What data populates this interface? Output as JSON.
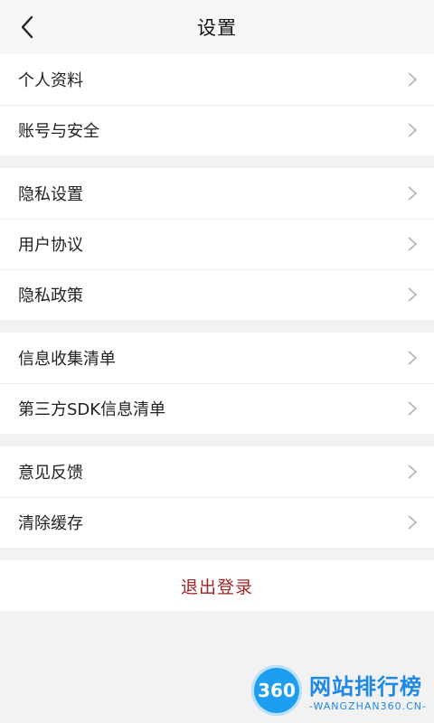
{
  "header": {
    "title": "设置",
    "back_icon": "chevron-left-icon"
  },
  "groups": [
    [
      {
        "label": "个人资料",
        "name": "personal-info"
      },
      {
        "label": "账号与安全",
        "name": "account-security"
      }
    ],
    [
      {
        "label": "隐私设置",
        "name": "privacy-settings"
      },
      {
        "label": "用户协议",
        "name": "user-agreement"
      },
      {
        "label": "隐私政策",
        "name": "privacy-policy"
      }
    ],
    [
      {
        "label": "信息收集清单",
        "name": "info-collection-list"
      },
      {
        "label": "第三方SDK信息清单",
        "name": "third-party-sdk-list"
      }
    ],
    [
      {
        "label": "意见反馈",
        "name": "feedback"
      },
      {
        "label": "清除缓存",
        "name": "clear-cache"
      }
    ]
  ],
  "logout": {
    "label": "退出登录"
  },
  "watermark": {
    "logo_text": "360",
    "title": "网站排行榜",
    "subtitle": "-WANGZHAN360.CN-"
  },
  "colors": {
    "logout": "#a42424",
    "background": "#f2f2f2",
    "accent_watermark": "#1e88e5"
  }
}
